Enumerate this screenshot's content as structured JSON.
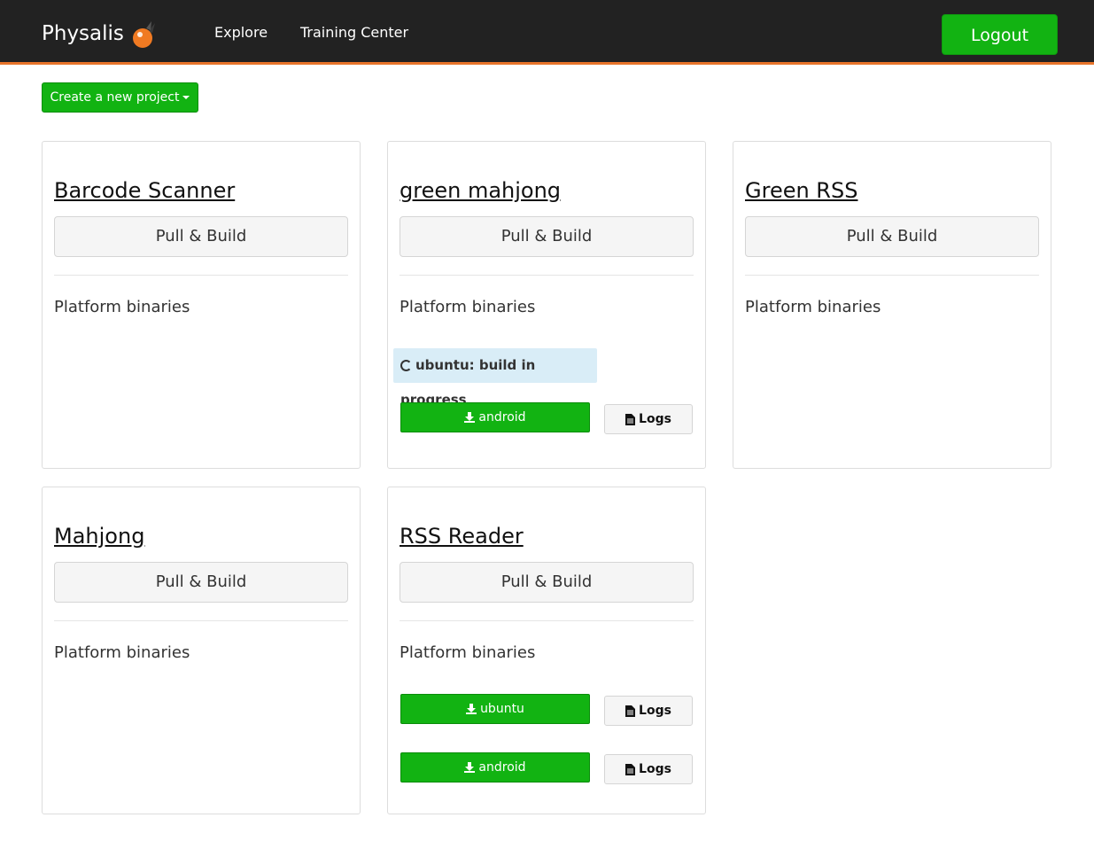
{
  "navbar": {
    "brand": "Physalis",
    "links": [
      "Explore",
      "Training Center"
    ],
    "logout_label": "Logout",
    "accent_color": "#e8742a"
  },
  "toolbar": {
    "create_label": "Create a new project"
  },
  "common": {
    "pull_build_label": "Pull & Build",
    "platform_binaries_label": "Platform binaries",
    "logs_label": "Logs"
  },
  "projects": [
    {
      "name": "Barcode Scanner"
    },
    {
      "name": "green mahjong",
      "status": "ubuntu: build in progress",
      "binaries": [
        "android"
      ]
    },
    {
      "name": "Green RSS"
    },
    {
      "name": "Mahjong"
    },
    {
      "name": "RSS Reader",
      "binaries": [
        "ubuntu",
        "android"
      ]
    }
  ],
  "colors": {
    "primary_green": "#12b312",
    "navbar_bg": "#222222",
    "info_bg": "#d9edf7"
  }
}
